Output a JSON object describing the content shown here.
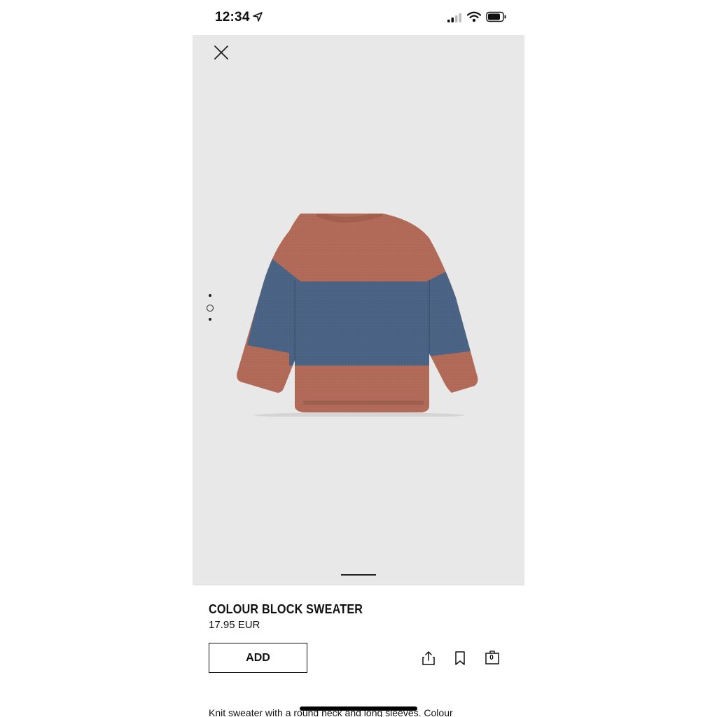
{
  "status_bar": {
    "time": "12:34"
  },
  "product": {
    "name": "COLOUR BLOCK SWEATER",
    "price": "17.95 EUR",
    "add_label": "ADD",
    "bag_count": "0",
    "description": "Knit sweater with a round neck and long sleeves. Colour"
  },
  "gallery": {
    "image_count": 3,
    "active_index": 1
  },
  "icons": {
    "close": "close-icon",
    "share": "share-icon",
    "bookmark": "bookmark-icon",
    "bag": "shopping-bag-icon"
  },
  "colors": {
    "sweater_rust": "#b26b58",
    "sweater_blue": "#4b6384",
    "gallery_bg": "#e8e8e8"
  }
}
